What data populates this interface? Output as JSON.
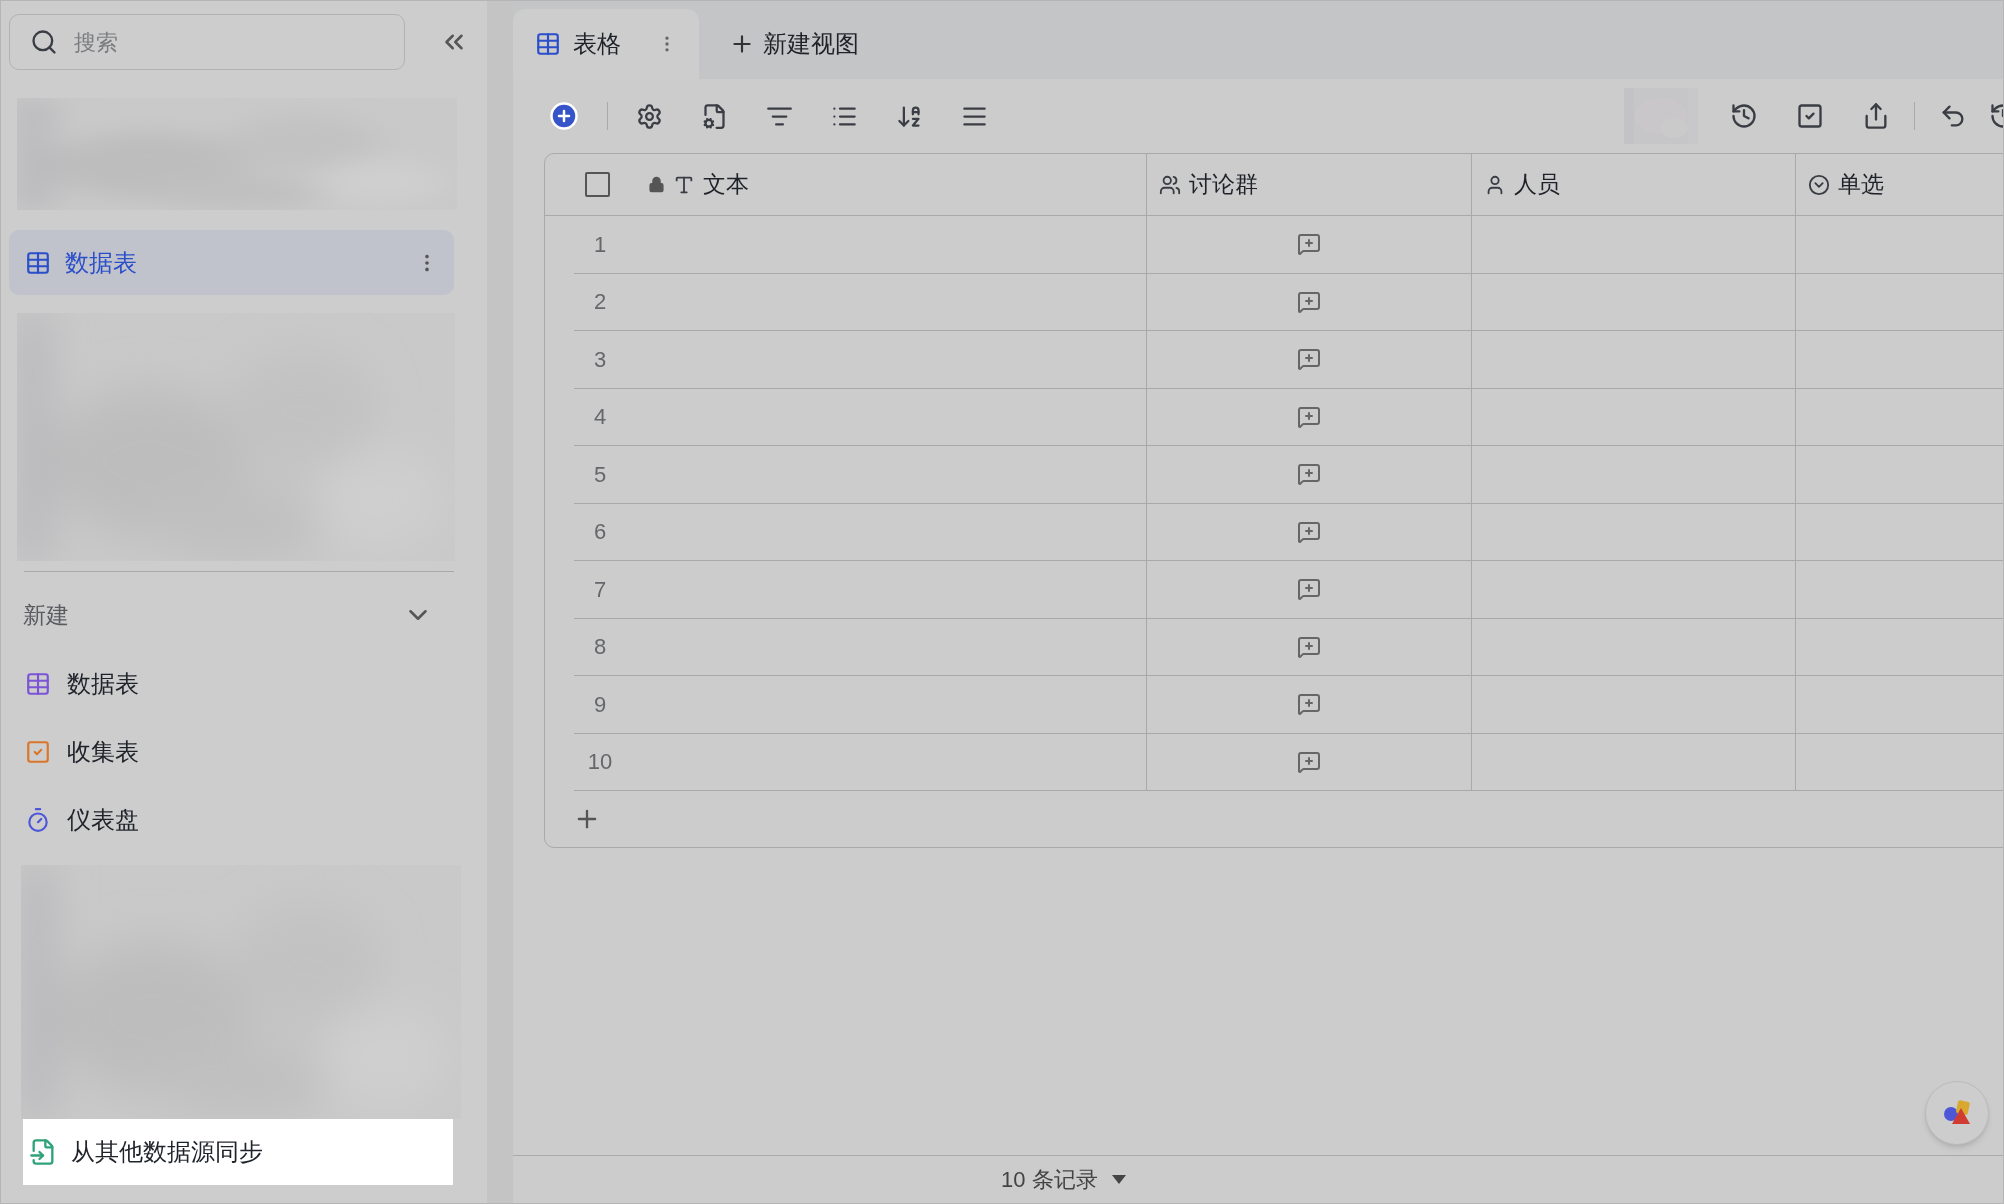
{
  "sidebar": {
    "search": {
      "placeholder": "搜索"
    },
    "tables": [
      {
        "label": "数据表",
        "selected": true
      }
    ],
    "new_section": {
      "title": "新建",
      "expanded": true,
      "items": [
        {
          "label": "数据表",
          "kind": "table"
        },
        {
          "label": "收集表",
          "kind": "form"
        },
        {
          "label": "仪表盘",
          "kind": "dashboard"
        }
      ]
    },
    "sync_item": {
      "label": "从其他数据源同步"
    }
  },
  "views": {
    "tabs": [
      {
        "label": "表格",
        "selected": true
      }
    ],
    "new_view": "新建视图"
  },
  "table": {
    "header_checkbox": {
      "checked": false
    },
    "columns": [
      {
        "label": "文本",
        "kind": "text",
        "locked": true
      },
      {
        "label": "讨论群",
        "kind": "group",
        "locked": false
      },
      {
        "label": "人员",
        "kind": "person",
        "locked": false
      },
      {
        "label": "单选",
        "kind": "select",
        "locked": false
      }
    ],
    "rows": [
      {
        "number": "1"
      },
      {
        "number": "2"
      },
      {
        "number": "3"
      },
      {
        "number": "4"
      },
      {
        "number": "5"
      },
      {
        "number": "6"
      },
      {
        "number": "7"
      },
      {
        "number": "8"
      },
      {
        "number": "9"
      },
      {
        "number": "10"
      }
    ]
  },
  "footer": {
    "record_count": "10 条记录"
  }
}
